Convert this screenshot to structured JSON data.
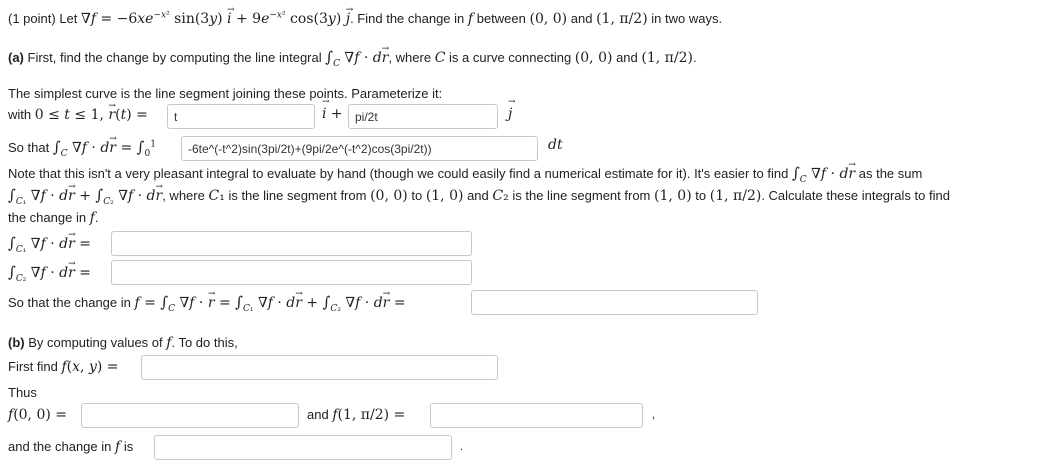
{
  "header": {
    "points_label": "(1 point)",
    "let": "Let",
    "find_text": ". Find the change in",
    "between_text": "between",
    "and": "and",
    "in_two_ways": "in two ways."
  },
  "part_a": {
    "label": "(a)",
    "text1": "First, find the change by computing the line integral",
    "text2": ", where",
    "text3": "is a curve connecting",
    "simplest": "The simplest curve is the line segment joining these points. Parameterize it:",
    "with": "with",
    "so_that": "So that",
    "note1": "Note that this isn't a very pleasant integral to evaluate by hand (though we could easily find a numerical estimate for it). It's easier to find",
    "note1b": "as the sum",
    "note2a": ", where",
    "note2b": "is the line segment from",
    "note2c": "to",
    "note2d": "and",
    "note2e": "is the line segment from",
    "note2f": "to",
    "note2g": ". Calculate these integrals to find",
    "note3": "the change in",
    "change_in_text": "So that the change in"
  },
  "part_b": {
    "label": "(b)",
    "text": "By computing values of",
    "text2": ". To do this,",
    "first_find": "First find",
    "thus": "Thus",
    "and": "and",
    "change_is": "and the change in",
    "is": "is"
  },
  "answers": {
    "r_i": "t",
    "r_j": "pi/2t",
    "integrand": "-6te^(-t^2)sin(3pi/2t)+(9pi/2e^(-t^2)cos(3pi/2t))",
    "c1": "",
    "c2": "",
    "total": "",
    "f_xy": "",
    "f00": "",
    "f1pi2": "",
    "change": ""
  }
}
